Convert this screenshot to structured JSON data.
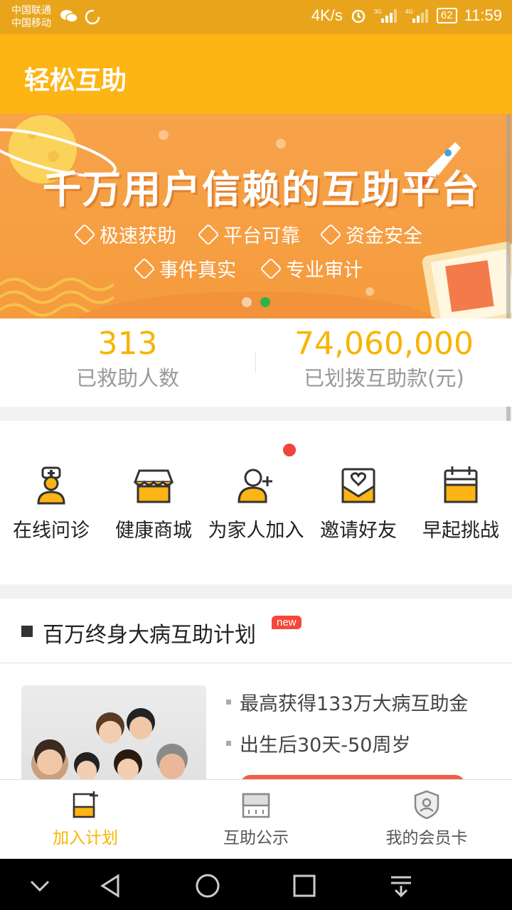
{
  "status_bar": {
    "carrier_1": "中国联通",
    "carrier_2": "中国移动",
    "speed": "4K/s",
    "signal_1": "3G",
    "signal_2": "4G",
    "battery": "62",
    "time": "11:59",
    "icons": [
      "wechat-icon",
      "loading-icon",
      "alarm-icon",
      "signal-icon"
    ]
  },
  "app_bar": {
    "title": "轻松互助"
  },
  "banner": {
    "headline": "千万用户信赖的互助平台",
    "features": [
      "极速获助",
      "平台可靠",
      "资金安全",
      "事件真实",
      "专业审计"
    ],
    "slide_count": 2,
    "active_slide": 2,
    "colors": {
      "background": "#f7a34a",
      "active_dot": "#2eb34a"
    }
  },
  "stats": [
    {
      "value": "313",
      "label": "已救助人数"
    },
    {
      "value": "74,060,000",
      "label": "已划拨互助款(元)"
    }
  ],
  "quick_actions": [
    {
      "label": "在线问诊",
      "icon": "doctor-icon"
    },
    {
      "label": "健康商城",
      "icon": "shop-icon"
    },
    {
      "label": "为家人加入",
      "icon": "add-user-icon"
    },
    {
      "label": "邀请好友",
      "icon": "invite-envelope-icon"
    },
    {
      "label": "早起挑战",
      "icon": "calendar-icon"
    }
  ],
  "plan": {
    "title": "百万终身大病互助计划",
    "badge": "new",
    "bullets": [
      "最高获得133万大病互助金",
      "出生后30天-50周岁"
    ]
  },
  "tab_bar": {
    "tabs": [
      {
        "label": "加入计划",
        "icon": "join-plan-icon",
        "active": true
      },
      {
        "label": "互助公示",
        "icon": "announcement-icon",
        "active": false
      },
      {
        "label": "我的会员卡",
        "icon": "member-card-icon",
        "active": false
      }
    ]
  },
  "colors": {
    "accent": "#fdb415",
    "status_bar": "#e8a51c",
    "highlight_text": "#f8b400",
    "badge_red": "#f7473a"
  }
}
